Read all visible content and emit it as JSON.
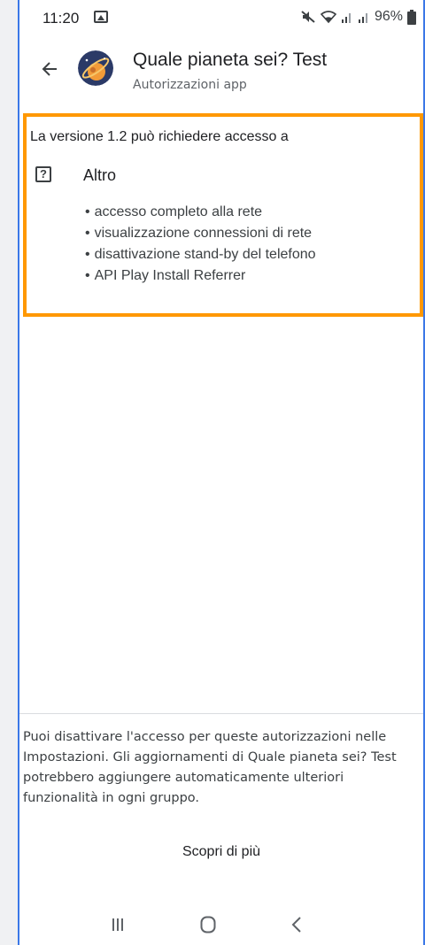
{
  "status_bar": {
    "time": "11:20",
    "battery": "96%",
    "icons": [
      "gallery-icon",
      "mute-icon",
      "wifi-icon",
      "signal-icon",
      "signal-icon",
      "battery-icon"
    ]
  },
  "header": {
    "title": "Quale pianeta sei? Test",
    "subtitle": "Autorizzazioni app",
    "back_icon": "back-arrow-icon",
    "app_icon": "planet-app-icon"
  },
  "permissions": {
    "version_heading": "La versione 1.2 può richiedere accesso a",
    "group": {
      "icon": "question-icon",
      "title": "Altro",
      "items": [
        "accesso completo alla rete",
        "visualizzazione connessioni di rete",
        "disattivazione stand-by del telefono",
        "API Play Install Referrer"
      ]
    }
  },
  "footer": {
    "text": "Puoi disattivare l'accesso per queste autorizzazioni nelle Impostazioni. Gli aggiornamenti di Quale pianeta sei? Test potrebbero aggiungere automaticamente ulteriori funzionalità in ogni gruppo.",
    "learn_more": "Scopri di più"
  },
  "nav_bar": {
    "icons": [
      "recent-apps-icon",
      "home-icon",
      "back-icon"
    ]
  },
  "colors": {
    "highlight": "#ff9800",
    "frame": "#3b78e7"
  }
}
